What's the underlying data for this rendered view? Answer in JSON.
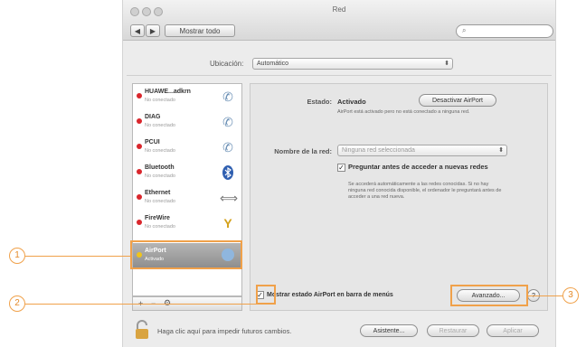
{
  "window": {
    "title": "Red"
  },
  "toolbar": {
    "back": "◀",
    "forward": "▶",
    "show_all": "Mostrar todo",
    "search_placeholder": ""
  },
  "location": {
    "label": "Ubicación:",
    "value": "Automático"
  },
  "services": [
    {
      "name": "HUAWE...adkrn",
      "status": "No conectado",
      "icon": "phone-icon"
    },
    {
      "name": "DIAG",
      "status": "No conectado",
      "icon": "phone-icon"
    },
    {
      "name": "PCUI",
      "status": "No conectado",
      "icon": "phone-icon"
    },
    {
      "name": "Bluetooth",
      "status": "No conectado",
      "icon": "bluetooth-icon"
    },
    {
      "name": "Ethernet",
      "status": "No conectado",
      "icon": "ethernet-icon"
    },
    {
      "name": "FireWire",
      "status": "No conectado",
      "icon": "firewire-icon"
    },
    {
      "name": "AirPort",
      "status": "Activado",
      "icon": "wifi-icon"
    }
  ],
  "sidebar_controls": {
    "add": "+",
    "remove": "−",
    "gear": "⚙"
  },
  "detail": {
    "status_label": "Estado:",
    "status_value": "Activado",
    "toggle_button": "Desactivar AirPort",
    "status_desc": "AirPort está activado pero no está conectado a ninguna red.",
    "network_label": "Nombre de la red:",
    "network_value": "Ninguna red seleccionada",
    "ask_label": "Preguntar antes de acceder a nuevas redes",
    "ask_desc": "Se accederá automáticamente a las redes conocidas. Si no hay ninguna red conocida disponible, el ordenador le preguntará antes de acceder a una red nueva.",
    "menu_bar_label": "Mostrar estado AirPort en barra de menús",
    "advanced_button": "Avanzado...",
    "help_button": "?"
  },
  "footer": {
    "lock_text": "Haga clic aquí para impedir futuros cambios.",
    "assistant_button": "Asistente...",
    "revert_button": "Restaurar",
    "apply_button": "Aplicar"
  },
  "callouts": [
    "1",
    "2",
    "3"
  ],
  "colors": {
    "callout": "#f0a14a",
    "status_dot": "#d9262c",
    "selected_row": "#9a9a9a"
  }
}
